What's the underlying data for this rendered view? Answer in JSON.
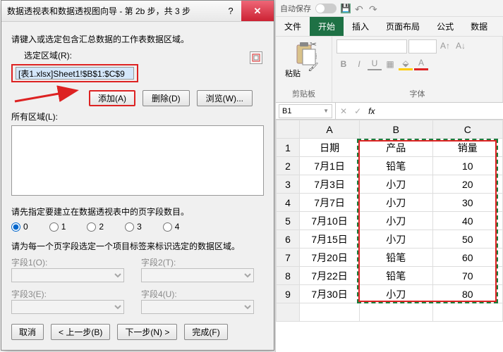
{
  "dialog": {
    "title": "数据透视表和数据透视图向导 - 第 2b 步，共 3 步",
    "instruction": "请键入或选定包含汇总数据的工作表数据区域。",
    "range_label": "选定区域(R):",
    "range_value": "[表1.xlsx]Sheet1!$B$1:$C$9",
    "add_btn": "添加(A)",
    "delete_btn": "删除(D)",
    "browse_btn": "浏览(W)...",
    "all_regions_label": "所有区域(L):",
    "page_fields_instruction": "请先指定要建立在数据透视表中的页字段数目。",
    "radios": [
      "0",
      "1",
      "2",
      "3",
      "4"
    ],
    "field_label_instruction": "请为每一个页字段选定一个项目标签来标识选定的数据区域。",
    "field_labels": [
      "字段1(O):",
      "字段2(T):",
      "字段3(E):",
      "字段4(U):"
    ],
    "cancel": "取消",
    "back": "< 上一步(B)",
    "next": "下一步(N) >",
    "finish": "完成(F)"
  },
  "excel": {
    "autosave": "自动保存",
    "tabs": [
      "文件",
      "开始",
      "插入",
      "页面布局",
      "公式",
      "数据"
    ],
    "group_clipboard": "剪贴板",
    "group_font": "字体",
    "paste_label": "粘贴",
    "name_box": "B1",
    "headers": [
      "",
      "A",
      "B",
      "C"
    ],
    "colA_header": "日期",
    "colB_header": "产品",
    "colC_header": "销量",
    "rows": [
      {
        "n": 1,
        "a": "日期",
        "b": "产品",
        "c": "销量"
      },
      {
        "n": 2,
        "a": "7月1日",
        "b": "铅笔",
        "c": "10"
      },
      {
        "n": 3,
        "a": "7月3日",
        "b": "小刀",
        "c": "20"
      },
      {
        "n": 4,
        "a": "7月7日",
        "b": "小刀",
        "c": "30"
      },
      {
        "n": 5,
        "a": "7月10日",
        "b": "小刀",
        "c": "40"
      },
      {
        "n": 6,
        "a": "7月15日",
        "b": "小刀",
        "c": "50"
      },
      {
        "n": 7,
        "a": "7月20日",
        "b": "铅笔",
        "c": "60"
      },
      {
        "n": 8,
        "a": "7月22日",
        "b": "铅笔",
        "c": "70"
      },
      {
        "n": 9,
        "a": "7月30日",
        "b": "小刀",
        "c": "80"
      }
    ]
  },
  "chart_data": {
    "type": "table",
    "headers": [
      "日期",
      "产品",
      "销量"
    ],
    "rows": [
      [
        "7月1日",
        "铅笔",
        10
      ],
      [
        "7月3日",
        "小刀",
        20
      ],
      [
        "7月7日",
        "小刀",
        30
      ],
      [
        "7月10日",
        "小刀",
        40
      ],
      [
        "7月15日",
        "小刀",
        50
      ],
      [
        "7月20日",
        "铅笔",
        60
      ],
      [
        "7月22日",
        "铅笔",
        70
      ],
      [
        "7月30日",
        "小刀",
        80
      ]
    ]
  }
}
